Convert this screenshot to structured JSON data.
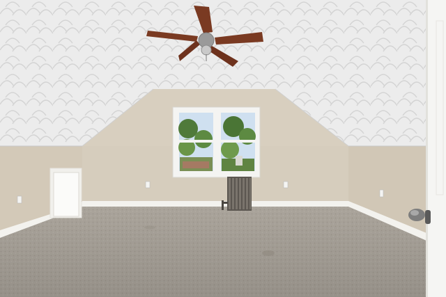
{
  "scene": {
    "description_free": true,
    "colors": {
      "wall": "#d6cdbd",
      "wall_shadow": "#c9bfad",
      "ceiling": "#eeeeee",
      "ceiling_texture": "#d9d9d9",
      "carpet": "#aaa49b",
      "baseboard": "#f3f2ee",
      "window_frame": "#f4f4f2",
      "foliage": "#4f7a3a",
      "sky": "#cfe0f0",
      "fan_blade": "#7a3a22",
      "radiator": "#5b5650",
      "door": "#f5f5f3",
      "door_knob": "#6c6c6c"
    },
    "icons": [
      "ceiling-fan-icon",
      "window-icon",
      "radiator-icon",
      "access-door-icon",
      "door-knob-icon",
      "outlet-icon"
    ]
  }
}
